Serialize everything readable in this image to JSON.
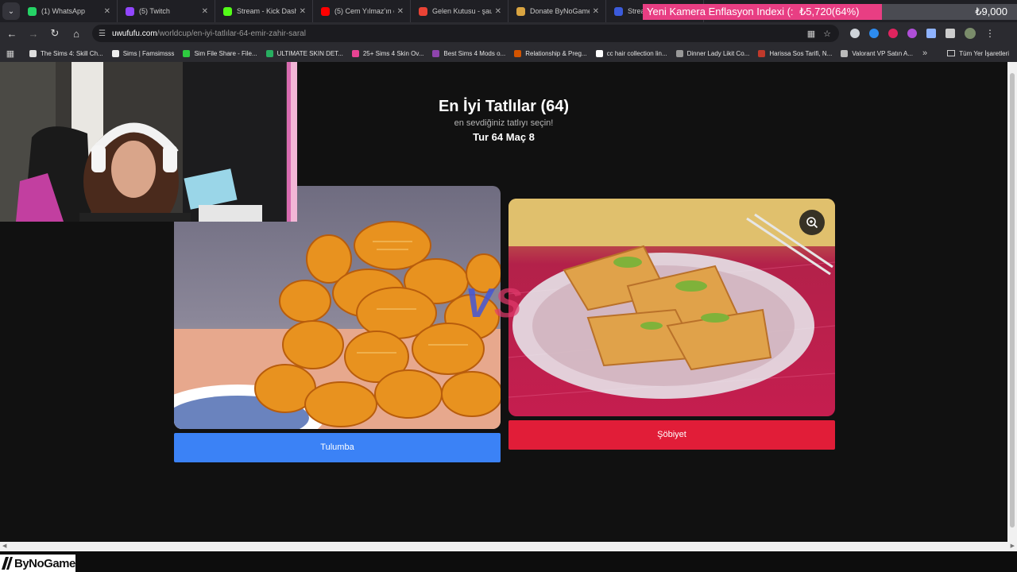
{
  "browser": {
    "tabs": [
      {
        "label": "(1) WhatsApp",
        "icon": "whatsapp-icon",
        "color": "#25d366"
      },
      {
        "label": "(5) Twitch",
        "icon": "twitch-icon",
        "color": "#9146ff"
      },
      {
        "label": "Stream - Kick Dashbo",
        "icon": "kick-icon",
        "color": "#53fc18"
      },
      {
        "label": "(5) Cem Yılmaz'ın en",
        "icon": "youtube-icon",
        "color": "#ff0000"
      },
      {
        "label": "Gelen Kutusu - şaucy",
        "icon": "gmail-icon",
        "color": "#ea4335"
      },
      {
        "label": "Donate ByNoGame",
        "icon": "bynogame-icon",
        "color": "#d9a441"
      },
      {
        "label": "Stream",
        "icon": "stream-icon",
        "color": "#3b5bdb"
      }
    ],
    "url_host": "uwufufu.com",
    "url_path": "/worldcup/en-iyi-tatlılar-64-emir-zahir-saral",
    "bookmarks": [
      {
        "label": "The Sims 4: Skill Ch...",
        "color": "#dddddd"
      },
      {
        "label": "Sims | Famsimsss",
        "color": "#eeeeee"
      },
      {
        "label": "Sim File Share - File...",
        "color": "#2ecc40"
      },
      {
        "label": "ULTIMATE SKIN DET...",
        "color": "#27ae60"
      },
      {
        "label": "25+ Sims 4 Skin Ov...",
        "color": "#e84393"
      },
      {
        "label": "Best Sims 4 Mods o...",
        "color": "#8e44ad"
      },
      {
        "label": "Relationship & Preg...",
        "color": "#d35400"
      },
      {
        "label": "cc hair collection lin...",
        "color": "#ffffff"
      },
      {
        "label": "Dinner Lady Likit Co...",
        "color": "#999999"
      },
      {
        "label": "Harissa Sos Tarifi, N...",
        "color": "#c0392b"
      },
      {
        "label": "Valorant VP Satın A...",
        "color": "#bbbbbb"
      }
    ],
    "all_bookmarks_label": "Tüm Yer İşaretleri"
  },
  "overlay": {
    "title": "Yeni Kamera Enflasyon Indexi (:",
    "current": "₺5,720(64%)",
    "goal": "₺9,000",
    "progress": 0.64,
    "fill_color": "#e83e83"
  },
  "page": {
    "title": "En İyi Tatlılar (64)",
    "subtitle": "en sevdiğiniz tatlıyı seçin!",
    "round": "Tur 64 Maç 8",
    "vs_v": "V",
    "vs_s": "S",
    "left_choice": "Tulumba",
    "right_choice": "Şöbiyet",
    "left_color": "#3b82f6",
    "right_color": "#e11d38"
  },
  "footer": {
    "logo_text": "ByNoGame"
  }
}
